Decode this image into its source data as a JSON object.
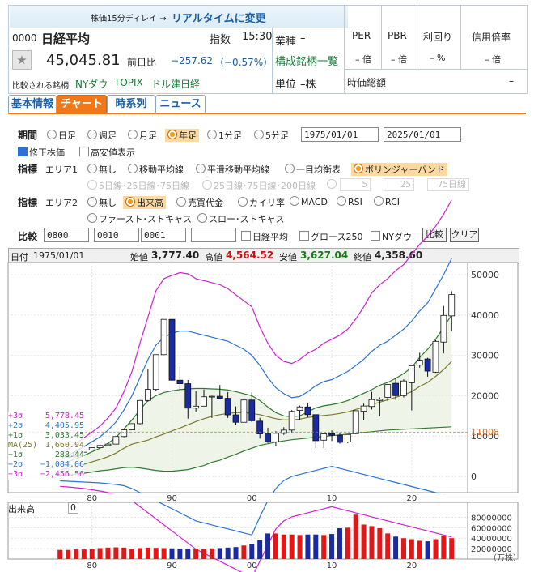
{
  "header": {
    "delay_note": "株価15分ディレイ → ",
    "realtime_link": "リアルタイムに変更",
    "code": "0000",
    "name": "日経平均",
    "index_label": "指数",
    "time": "15:30",
    "price": "45,045.81",
    "change_label": "前日比",
    "change": "−257.62",
    "change_pct": "（−0.57%）",
    "compare_label": "比較される銘柄",
    "compare_links": [
      "NYダウ",
      "TOPIX",
      "ドル建日経"
    ],
    "industry_label": "業種",
    "industry_value": "–",
    "constituents_link": "構成銘柄一覧",
    "unit_label": "単位",
    "unit_value": "–株",
    "per_label": "PER",
    "pbr_label": "PBR",
    "yield_label": "利回り",
    "margin_label": "信用倍率",
    "per_value": "– 倍",
    "pbr_value": "– 倍",
    "yield_value": "– %",
    "margin_value": "– 倍",
    "mcap_label": "時価総額",
    "mcap_value": "–"
  },
  "tabs": [
    "基本情報",
    "チャート",
    "時系列",
    "ニュース"
  ],
  "controls": {
    "period_label": "期間",
    "periods": [
      "日足",
      "週足",
      "月足",
      "年足",
      "1分足",
      "5分足"
    ],
    "selected_period": "年足",
    "date_from": "1975/01/01",
    "date_to": "2025/01/01",
    "adjusted": "修正株価",
    "highlow": "高安値表示",
    "indicator_label": "指標",
    "area1_label": "エリア1",
    "area1_options": [
      "無し",
      "移動平均線",
      "平滑移動平均線",
      "一目均衡表",
      "ボリンジャーバンド"
    ],
    "area1_sub": [
      "5日線･25日線･75日線",
      "25日線･75日線･200日線",
      "5",
      "25",
      "75日線"
    ],
    "area2_label": "エリア2",
    "area2_options": [
      "無し",
      "出来高",
      "売買代金",
      "カイリ率",
      "MACD",
      "RSI",
      "RCI",
      "ファースト･ストキャス",
      "スロー･ストキャス"
    ],
    "compare_label": "比較",
    "compare_codes": [
      "0800",
      "0010",
      "0001",
      ""
    ],
    "compare_checks": [
      "日経平均",
      "グロース250",
      "NYダウ"
    ],
    "compare_btn": "比較",
    "clear_btn": "クリア"
  },
  "chart_info": {
    "date_label": "日付",
    "date": "1975/01/01",
    "open_label": "始値",
    "open": "3,777.40",
    "high_label": "高値",
    "high": "4,564.52",
    "low_label": "安値",
    "low": "3,627.04",
    "close_label": "終値",
    "close": "4,358.60"
  },
  "bb_legend": [
    {
      "label": "+3σ",
      "value": "5,778.45",
      "color": "#d020d0"
    },
    {
      "label": "+2σ",
      "value": "4,405.95",
      "color": "#2a72d8"
    },
    {
      "label": "+1σ",
      "value": "3,033.45",
      "color": "#2f7a2f"
    },
    {
      "label": "MA(25)",
      "value": "1,660.94",
      "color": "#7a7a2a"
    },
    {
      "label": "−1σ",
      "value": "288.44",
      "color": "#2f7a2f"
    },
    {
      "label": "−2σ",
      "value": "−1,084.06",
      "color": "#2a72d8"
    },
    {
      "label": "−3σ",
      "value": "−2,456.56",
      "color": "#d020d0"
    }
  ],
  "volume_label": "出来高",
  "volume_value": "0",
  "volume_unit": "（万株）",
  "price_marker": "11008",
  "chart_data": {
    "type": "candlestick",
    "x": [
      1976,
      1977,
      1978,
      1979,
      1980,
      1981,
      1982,
      1983,
      1984,
      1985,
      1986,
      1987,
      1988,
      1989,
      1990,
      1991,
      1992,
      1993,
      1994,
      1995,
      1996,
      1997,
      1998,
      1999,
      2000,
      2001,
      2002,
      2003,
      2004,
      2005,
      2006,
      2007,
      2008,
      2009,
      2010,
      2011,
      2012,
      2013,
      2014,
      2015,
      2016,
      2017,
      2018,
      2019,
      2020,
      2021,
      2022,
      2023,
      2024,
      2025
    ],
    "open": [
      4359,
      4990,
      4866,
      6002,
      6570,
      7116,
      7682,
      8016,
      9894,
      11543,
      13083,
      18821,
      21564,
      30159,
      38916,
      23849,
      22983,
      16925,
      17417,
      19723,
      19868,
      19361,
      15259,
      13416,
      18934,
      13691,
      10543,
      8579,
      10677,
      11488,
      16361,
      17225,
      15307,
      8991,
      10609,
      10229,
      8549,
      10604,
      16147,
      17325,
      18818,
      19594,
      23073,
      20039,
      23204,
      27575,
      29098,
      25834,
      33288,
      39781
    ],
    "high": [
      4990,
      5287,
      6097,
      6590,
      7188,
      8019,
      8026,
      9894,
      11577,
      13129,
      18936,
      26646,
      30159,
      38957,
      38713,
      27146,
      23901,
      21148,
      21552,
      20011,
      22666,
      20910,
      17352,
      19036,
      20833,
      14529,
      12081,
      11238,
      12195,
      16445,
      17563,
      18300,
      15307,
      10767,
      11408,
      10891,
      10433,
      16291,
      18030,
      20952,
      19592,
      22939,
      24448,
      24066,
      27602,
      30670,
      29388,
      33753,
      42224,
      45900
    ],
    "low": [
      4359,
      4866,
      4866,
      5936,
      6570,
      7116,
      6849,
      8016,
      9703,
      11543,
      12881,
      18544,
      21217,
      30159,
      20221,
      21456,
      14309,
      16079,
      17370,
      14485,
      19161,
      14488,
      12787,
      13232,
      13423,
      9382,
      8303,
      7607,
      10299,
      10770,
      14045,
      14669,
      6994,
      7054,
      8796,
      8135,
      8238,
      10487,
      13885,
      16592,
      14864,
      18650,
      18948,
      19561,
      16358,
      26954,
      24717,
      25661,
      30487,
      36000
    ],
    "close": [
      4990,
      4866,
      6002,
      6570,
      7116,
      7682,
      8016,
      9894,
      11543,
      13083,
      18821,
      21564,
      30159,
      38916,
      23849,
      22983,
      16925,
      17417,
      19723,
      19868,
      19361,
      15259,
      13416,
      18934,
      13786,
      10543,
      8579,
      10677,
      11489,
      16111,
      17226,
      15308,
      8860,
      10546,
      10229,
      8455,
      10395,
      16291,
      17451,
      19034,
      19114,
      22765,
      20015,
      23657,
      27444,
      28792,
      26095,
      33464,
      39895,
      45046
    ],
    "bb_series": [
      {
        "name": "+3σ",
        "values": [
          5778,
          6800,
          8200,
          9600,
          11000,
          12500,
          14500,
          17000,
          21000,
          26000,
          33000,
          39500,
          46000,
          49000,
          49800,
          50500,
          50200,
          49000,
          48500,
          48000,
          47500,
          46500,
          45000,
          43500,
          42000,
          37000,
          33000,
          30000,
          28500,
          28000,
          29000,
          30500,
          31500,
          33000,
          34000,
          35000,
          36500,
          39000,
          42000,
          45500,
          47500,
          49000,
          51000,
          52500,
          55000,
          57500,
          59500,
          62000,
          65000,
          68500
        ]
      },
      {
        "name": "+2σ",
        "values": [
          4406,
          5200,
          6300,
          7400,
          8600,
          9800,
          11500,
          13500,
          16500,
          20000,
          24500,
          29000,
          32500,
          34500,
          35500,
          36000,
          36000,
          35500,
          35000,
          34500,
          34000,
          33500,
          32500,
          31500,
          30000,
          27500,
          24500,
          22000,
          20500,
          19500,
          19800,
          21000,
          22500,
          23500,
          24000,
          25000,
          26000,
          27500,
          29000,
          31000,
          32500,
          33500,
          35000,
          36500,
          38500,
          41000,
          43000,
          46500,
          50000,
          54000
        ]
      },
      {
        "name": "+1σ",
        "values": [
          3033,
          3600,
          4400,
          5200,
          6100,
          7000,
          8200,
          9700,
          11800,
          14000,
          16500,
          18800,
          20000,
          20800,
          21200,
          21500,
          21700,
          21800,
          21800,
          21700,
          21600,
          21400,
          21000,
          20500,
          20000,
          18800,
          17200,
          15800,
          15000,
          14800,
          15000,
          16000,
          17000,
          17500,
          17800,
          18200,
          18800,
          19700,
          20600,
          21500,
          22600,
          23300,
          24300,
          25500,
          27000,
          29500,
          31500,
          34000,
          37000,
          40000
        ]
      },
      {
        "name": "MA(25)",
        "values": [
          1661,
          2000,
          2500,
          3000,
          3600,
          4200,
          4900,
          5800,
          7000,
          8000,
          8500,
          9000,
          9800,
          10500,
          11300,
          12000,
          12800,
          13600,
          14300,
          14900,
          15300,
          15600,
          15800,
          15800,
          15600,
          15300,
          14800,
          14300,
          14000,
          14000,
          14200,
          14600,
          14900,
          15100,
          15300,
          15600,
          16000,
          16600,
          17200,
          17800,
          18400,
          19000,
          19600,
          20200,
          21000,
          22300,
          23300,
          24800,
          26500,
          28500
        ]
      },
      {
        "name": "−1σ",
        "values": [
          288,
          400,
          600,
          800,
          1100,
          1400,
          1600,
          1900,
          2200,
          2300,
          2100,
          1800,
          1500,
          1300,
          1300,
          1500,
          1700,
          2200,
          2700,
          3500,
          4000,
          4800,
          5500,
          6300,
          7000,
          7700,
          8100,
          8500,
          8800,
          9100,
          9300,
          9500,
          9700,
          9900,
          10100,
          10300,
          10500,
          10700,
          10900,
          11100,
          11300,
          11500,
          11600,
          11700,
          11800,
          11900,
          12000,
          12100,
          12200,
          12300
        ]
      },
      {
        "name": "−2σ",
        "values": [
          -1084,
          -1200,
          -1300,
          -1400,
          -1500,
          -1600,
          -1800,
          -2000,
          -2300,
          -3000,
          -4000,
          -5000,
          -6000,
          -7000,
          -8000,
          -9000,
          -10000,
          -11000,
          -11500,
          -12000,
          -12500,
          -13000,
          -13500,
          -14000,
          -14500,
          -10000,
          -6000,
          -3000,
          -1000,
          0,
          500,
          1000,
          1500,
          2000,
          2500,
          2000,
          1500,
          1000,
          500,
          0,
          -500,
          -1000,
          -1500,
          -2000,
          -2500,
          -3000,
          -3500,
          -4000,
          -4500,
          -5000
        ]
      },
      {
        "name": "−3σ",
        "values": [
          -2457,
          -2600,
          -2800,
          -3000,
          -3300,
          -3600,
          -4000,
          -4500,
          -5000,
          -6000,
          -7500,
          -9000,
          -10500,
          -12000,
          -13500,
          -15000,
          -16500,
          -18000,
          -19000,
          -20000,
          -21000,
          -22000,
          -23000,
          -24000,
          -25000,
          -21000,
          -17000,
          -13000,
          -11000,
          -10000,
          -9500,
          -9000,
          -8500,
          -8000,
          -7500,
          -8000,
          -8500,
          -9000,
          -9500,
          -10000,
          -10500,
          -11000,
          -11500,
          -12000,
          -12500,
          -13000,
          -13500,
          -14000,
          -14500,
          -15000
        ]
      }
    ],
    "volume": [
      17500000,
      17500000,
      18500000,
      18500000,
      19000000,
      21000000,
      22000000,
      22500000,
      22000000,
      20000000,
      21000000,
      22000000,
      21500000,
      21000000,
      20500000,
      20000000,
      19500000,
      19500000,
      19500000,
      20500000,
      21000000,
      22000000,
      23000000,
      26000000,
      29000000,
      36000000,
      49000000,
      49000000,
      47000000,
      47000000,
      46000000,
      47000000,
      47000000,
      46000000,
      48000000,
      59000000,
      60000000,
      85000000,
      66000000,
      63000000,
      59000000,
      49000000,
      43000000,
      40000000,
      38000000,
      35000000,
      34000000,
      38000000,
      45000000,
      40000000
    ],
    "volume_colors": [
      "up",
      "up",
      "up",
      "up",
      "up",
      "up",
      "up",
      "up",
      "up",
      "up",
      "up",
      "up",
      "up",
      "up",
      "down",
      "down",
      "down",
      "up",
      "up",
      "up",
      "down",
      "down",
      "down",
      "up",
      "down",
      "down",
      "down",
      "up",
      "up",
      "up",
      "up",
      "down",
      "down",
      "up",
      "down",
      "down",
      "up",
      "up",
      "up",
      "up",
      "up",
      "up",
      "down",
      "up",
      "up",
      "up",
      "down",
      "up",
      "up",
      "up"
    ],
    "xlabels": [
      "80",
      "90",
      "00",
      "10",
      "20"
    ],
    "xlabel_years": [
      1980,
      1990,
      2000,
      2010,
      2020
    ],
    "ylabels": [
      "50000",
      "40000",
      "30000",
      "20000",
      "10000",
      "0"
    ],
    "ylabel_values": [
      50000,
      40000,
      30000,
      20000,
      10000,
      0
    ],
    "vol_ylabels": [
      "80000000",
      "60000000",
      "40000000",
      "20000000"
    ],
    "vol_ylabel_values": [
      80000000,
      60000000,
      40000000,
      20000000
    ],
    "ylim": [
      -4000,
      53000
    ],
    "vol_ylim": [
      0,
      90000000
    ]
  }
}
